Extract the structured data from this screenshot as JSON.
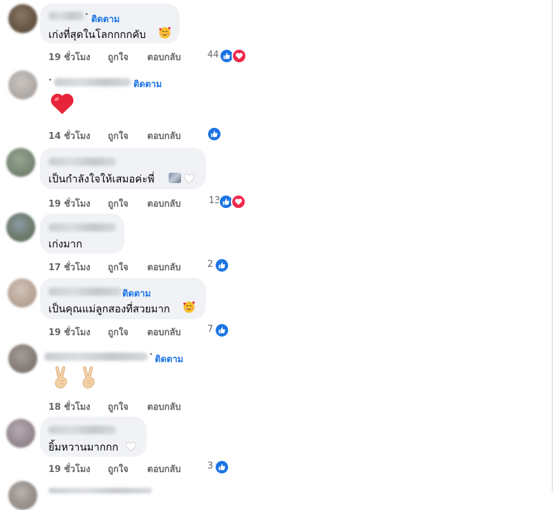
{
  "actions": {
    "like": "ถูกใจ",
    "reply": "ตอบกลับ"
  },
  "comments": [
    {
      "follow": "ติดตาม",
      "text": "เก่งที่สุดในโลกกกกคับ",
      "time": "19 ชั่วโมง",
      "reaction_count": "44",
      "reactions": [
        "like-icon",
        "love-icon"
      ]
    },
    {
      "follow": "ติดตาม",
      "text": "",
      "time": "14 ชั่วโมง",
      "reaction_count": "",
      "reactions": [
        "like-icon"
      ]
    },
    {
      "follow": "",
      "text": "เป็นกำลังใจให้เสมอค่ะพี่",
      "time": "19 ชั่วโมง",
      "reaction_count": "13",
      "reactions": [
        "like-icon",
        "love-icon"
      ]
    },
    {
      "follow": "",
      "text": "เก่งมาก",
      "time": "17 ชั่วโมง",
      "reaction_count": "2",
      "reactions": [
        "like-icon"
      ]
    },
    {
      "follow": "ติดตาม",
      "text": "เป็นคุณแม่ลูกสองที่สวยมาก",
      "time": "19 ชั่วโมง",
      "reaction_count": "7",
      "reactions": [
        "like-icon"
      ]
    },
    {
      "follow": "ติดตาม",
      "text": "",
      "time": "18 ชั่วโมง",
      "reaction_count": "",
      "reactions": []
    },
    {
      "follow": "",
      "text": "ยิ้มหวานมากกก",
      "time": "19 ชั่วโมง",
      "reaction_count": "3",
      "reactions": [
        "like-icon"
      ]
    }
  ],
  "colors": {
    "accent": "#1b74e4",
    "love": "#f02849",
    "bubble": "#f0f2f5",
    "meta": "#65676b"
  }
}
